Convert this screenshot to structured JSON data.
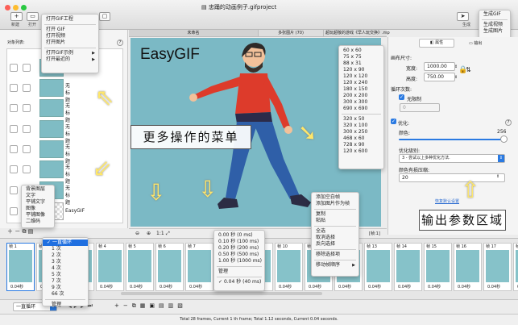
{
  "window": {
    "title": "忠踊的动画例子.gifproject"
  },
  "toolbar": {
    "new_label": "新建",
    "open_label": "打开",
    "generate_label": "生成",
    "generate_menu": [
      "生成GIF",
      "生成视频",
      "生成图片"
    ]
  },
  "file_menu": {
    "items": [
      "打开GIF工程",
      "打开 GIF",
      "打开视频",
      "打开图片",
      "打开GIF示例",
      "打开最近的"
    ]
  },
  "tabs": [
    "未命名",
    "多张图片 (70)",
    "超玩超敬的游戏《早人玩交换》.mp"
  ],
  "layers": {
    "header": "对象列表:",
    "help": "?",
    "untitled": "无标题",
    "gif_label": "EasyGIF",
    "add_menu": [
      "背景图层",
      "文字",
      "平铺文字",
      "图像",
      "平铺图像",
      "二维码"
    ]
  },
  "canvas": {
    "logo_text": "EasyGIF",
    "zoom_label": "1:1"
  },
  "size_menu": {
    "group1": [
      "60 x 60",
      "75 x 75",
      "88 x 31",
      "120 x 90",
      "120 x 120",
      "120 x 240",
      "180 x 150",
      "200 x 200",
      "300 x 300",
      "690 x 690"
    ],
    "group2": [
      "320 x 50",
      "320 x 100",
      "300 x 250",
      "468 x 60",
      "728 x 90",
      "120 x 600"
    ]
  },
  "context_menu": {
    "items": [
      "添加空白帧",
      "添加图片作为帧",
      "复制",
      "粘贴",
      "全选",
      "取消选择",
      "反向选择",
      "移除选择项",
      "移动帧顺序"
    ]
  },
  "callouts": {
    "menu": "更多操作的菜单",
    "output": "输出参数区域"
  },
  "right_panel": {
    "tab_props": "属性",
    "tab_output": "输出",
    "canvas_size_label": "画布尺寸:",
    "width_label": "宽度:",
    "width_value": "1000.00",
    "height_label": "高度:",
    "height_value": "750.00",
    "loop_label": "循环次数:",
    "infinite_label": "无限制",
    "loop_value": "0",
    "optimize_label": "优化:",
    "color_label": "颜色:",
    "color_value": "256",
    "opt_level_label": "优化级别:",
    "opt_level_value": "3 - 尝试以上多种优化方法.",
    "lossy_label": "颜色有损压缩:",
    "lossy_value": "20",
    "restore_defaults": "恢复默认设置",
    "help": "?",
    "frame_count": "[帧:1]"
  },
  "timeline": {
    "frames": [
      {
        "label": "帧 1",
        "time": "0.04秒"
      },
      {
        "label": "帧 2",
        "time": "0.04秒"
      },
      {
        "label": "帧 3",
        "time": "0.04秒"
      },
      {
        "label": "帧 4",
        "time": "0.04秒"
      },
      {
        "label": "帧 5",
        "time": "0.04秒"
      },
      {
        "label": "帧 6",
        "time": "0.04秒"
      },
      {
        "label": "帧 7",
        "time": "0.04秒"
      },
      {
        "label": "帧 8",
        "time": "0.04秒"
      },
      {
        "label": "帧 9",
        "time": "0.04秒"
      },
      {
        "label": "帧 10",
        "time": "0.04秒"
      },
      {
        "label": "帧 11",
        "time": "0.04秒"
      },
      {
        "label": "帧 12",
        "time": "0.04秒"
      },
      {
        "label": "帧 13",
        "time": "0.04秒"
      },
      {
        "label": "帧 14",
        "time": "0.04秒"
      },
      {
        "label": "帧 15",
        "time": "0.04秒"
      },
      {
        "label": "帧 16",
        "time": "0.04秒"
      },
      {
        "label": "帧 17",
        "time": "0.04秒"
      },
      {
        "label": "帧 18",
        "time": "0.04秒"
      }
    ],
    "loop_menu": [
      "一直循环",
      "1 次",
      "2 次",
      "3 次",
      "4 次",
      "5 次",
      "7 次",
      "9 次",
      "66 次",
      "管理"
    ],
    "loop_select": "一直循环",
    "delay_menu": [
      "0.00 秒 (0 ms)",
      "0.10 秒 (100 ms)",
      "0.20 秒 (200 ms)",
      "0.50 秒 (500 ms)",
      "1.00 秒 (1000 ms)",
      "管理",
      "0.04 秒 (40 ms)"
    ]
  },
  "status": "Total 28 frames, Current 1 th frame; Total 1.12 seconds, Current 0.04 seconds."
}
